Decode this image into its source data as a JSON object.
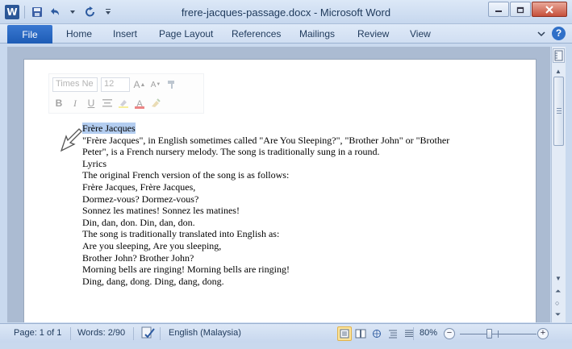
{
  "window": {
    "title": "frere-jacques-passage.docx - Microsoft Word",
    "app_icon_letter": "W"
  },
  "ribbon": {
    "file_label": "File",
    "tabs": [
      "Home",
      "Insert",
      "Page Layout",
      "References",
      "Mailings",
      "Review",
      "View"
    ],
    "help_label": "?"
  },
  "minitoolbar": {
    "font_name": "Times Ne",
    "font_size": "12",
    "bold": "B",
    "italic": "I",
    "underline": "U",
    "font_color_label": "A"
  },
  "document": {
    "lines": [
      "Frère Jacques",
      "\"Frère Jacques\", in English sometimes called \"Are You Sleeping?\", \"Brother John\" or \"Brother",
      "Peter\", is a French nursery melody. The song is traditionally sung in a round.",
      "Lyrics",
      "The original French version of the song is as follows:",
      "Frère Jacques, Frère Jacques,",
      "Dormez-vous? Dormez-vous?",
      "Sonnez les matines! Sonnez les matines!",
      "Din, dan, don. Din, dan, don.",
      "The song is traditionally translated into English as:",
      "Are you sleeping, Are you sleeping,",
      "Brother John? Brother John?",
      "Morning bells are ringing! Morning bells are ringing!",
      "Ding, dang, dong. Ding, dang, dong."
    ]
  },
  "status": {
    "page": "Page: 1 of 1",
    "words": "Words: 2/90",
    "language": "English (Malaysia)",
    "zoom": "80%",
    "zoom_value": 80
  },
  "colors": {
    "file_tab": "#2a68c3",
    "selection": "#b3cdf0",
    "accent": "#2b5797"
  }
}
